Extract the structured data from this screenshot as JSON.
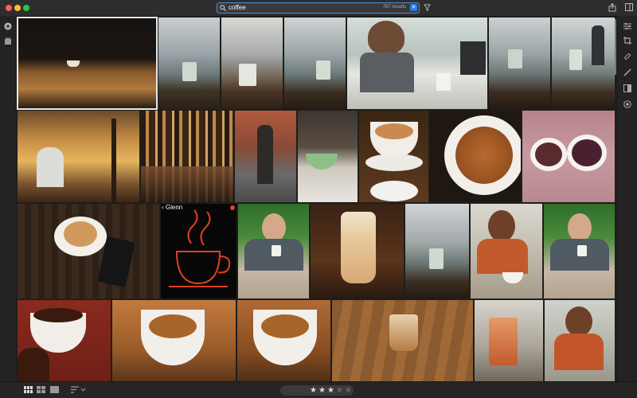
{
  "search": {
    "query": "coffee",
    "results": "767 results"
  },
  "stack_badge": {
    "label": "‹ Glenn"
  },
  "rating": {
    "stars": [
      "★",
      "★",
      "★",
      "★",
      "★"
    ],
    "filled": 3,
    "on_color": "#dddddd",
    "off_color": "#666666"
  },
  "icons": {
    "left_sidebar": [
      "add-icon",
      "library-icon"
    ],
    "right_sidebar": [
      "adjust-icon",
      "crop-icon",
      "heal-icon",
      "brush-icon",
      "gradient-icon",
      "radial-icon"
    ],
    "top_right": [
      "share-icon",
      "filter-icon"
    ],
    "bottom_left": [
      "square-grid-icon",
      "grid-icon",
      "detail-view-icon",
      "sort-icon"
    ],
    "bottom_center": [
      "flag-pick-icon",
      "flag-reject-icon"
    ]
  },
  "colors": {
    "accent": "#2b7de0",
    "app_bg": "#1e1e1e",
    "badge_dot": "#e04040"
  },
  "photos": [
    {
      "name": "photo-cafe-table-dark",
      "desc": "dark cafe table with cup"
    },
    {
      "name": "photo-bridge-mug-1",
      "desc": "bridge view with mug"
    },
    {
      "name": "photo-bridge-mug-2",
      "desc": "bridge view with mug"
    },
    {
      "name": "photo-bridge-mug-3",
      "desc": "bridge view with mug"
    },
    {
      "name": "photo-child-tablet",
      "desc": "child with tablet"
    },
    {
      "name": "photo-bridge-mug-4",
      "desc": "bridge view with mug"
    },
    {
      "name": "photo-bridge-man",
      "desc": "man at bridge"
    },
    {
      "name": "photo-cafe-interior",
      "desc": "cafe interior"
    },
    {
      "name": "photo-coffee-machines",
      "desc": "coffee machines"
    },
    {
      "name": "photo-man-street",
      "desc": "man on street"
    },
    {
      "name": "photo-green-cup",
      "desc": "green cup"
    },
    {
      "name": "photo-latte-art",
      "desc": "latte art"
    },
    {
      "name": "photo-espresso-closeup",
      "desc": "espresso close up"
    },
    {
      "name": "photo-two-cups",
      "desc": "two cups"
    },
    {
      "name": "photo-latte-phone",
      "desc": "latte with phone"
    },
    {
      "name": "photo-neon-cup",
      "desc": "neon cup sign"
    },
    {
      "name": "photo-man-cup-1",
      "desc": "man holding cup"
    },
    {
      "name": "photo-tall-latte",
      "desc": "tall latte"
    },
    {
      "name": "photo-bridge-mug-5",
      "desc": "bridge view with mug"
    },
    {
      "name": "photo-woman-cup",
      "desc": "woman with cup"
    },
    {
      "name": "photo-man-cup-2",
      "desc": "man holding cup"
    },
    {
      "name": "photo-coffee-beans",
      "desc": "coffee beans in cup"
    },
    {
      "name": "photo-espresso-1",
      "desc": "espresso cup"
    },
    {
      "name": "photo-espresso-2",
      "desc": "espresso cup"
    },
    {
      "name": "photo-cortado",
      "desc": "cortado on table"
    },
    {
      "name": "photo-iced-tea",
      "desc": "iced drink"
    },
    {
      "name": "photo-child-cup",
      "desc": "child with cup"
    }
  ]
}
